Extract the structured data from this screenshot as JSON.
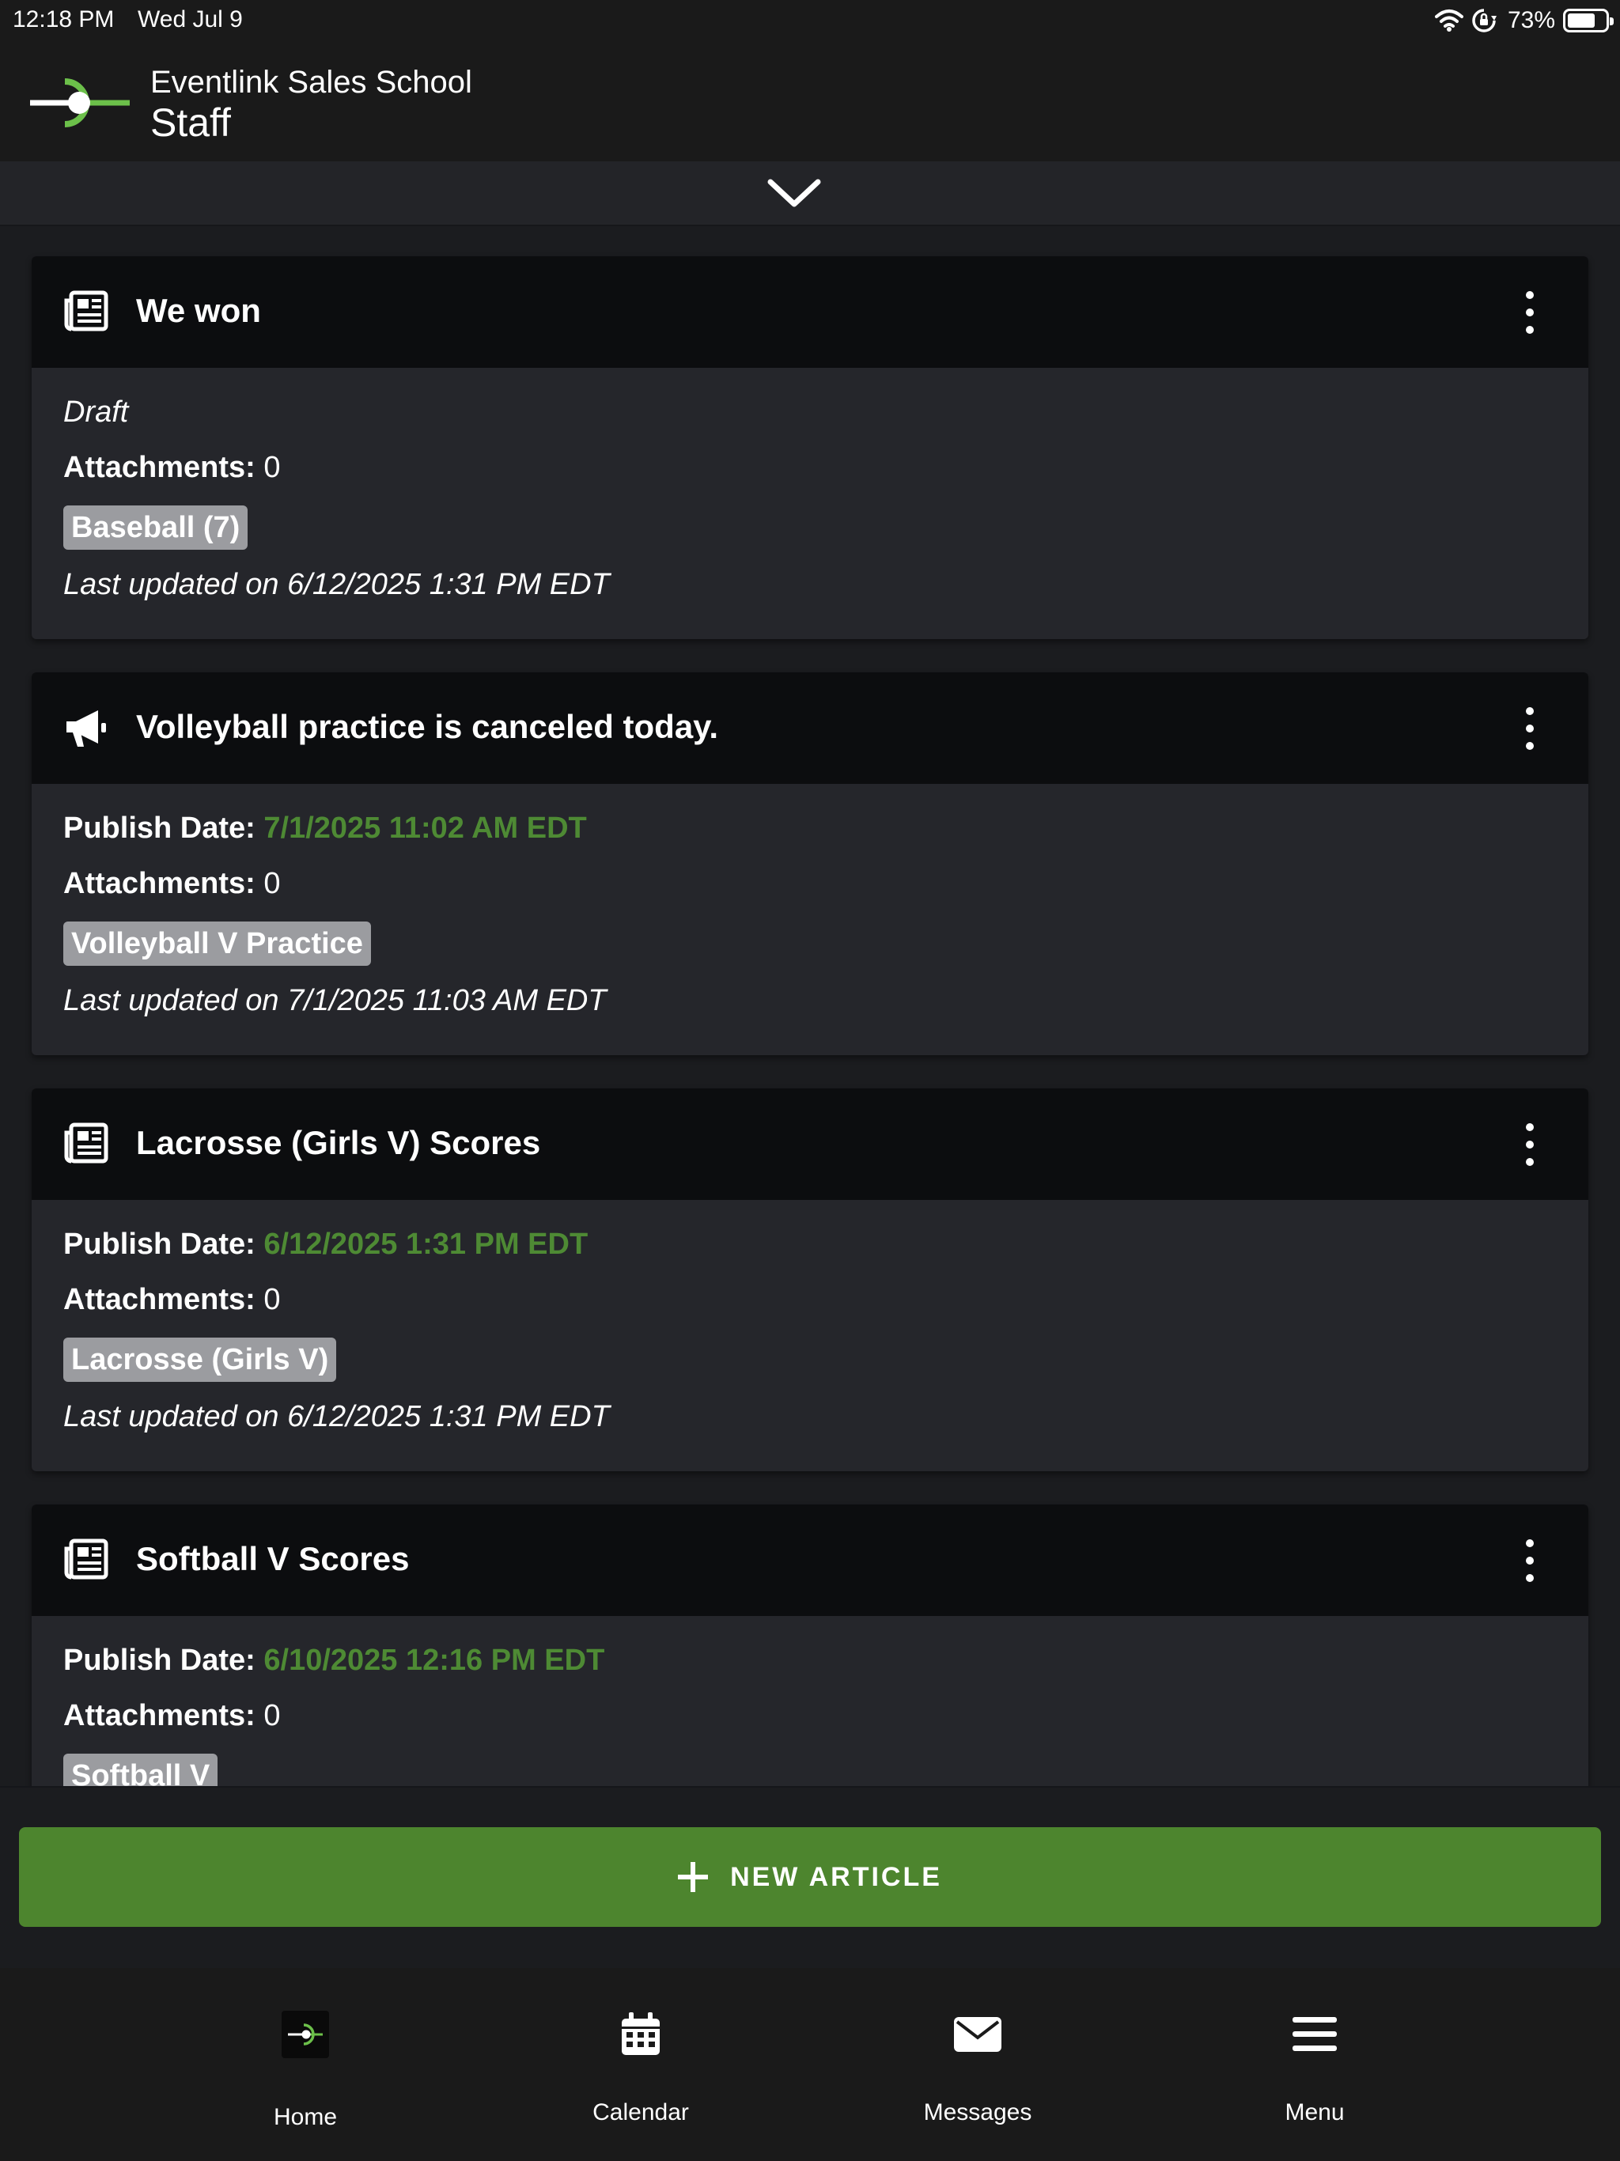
{
  "status_bar": {
    "time": "12:18 PM",
    "date": "Wed Jul 9",
    "battery_percent": "73%",
    "battery_level": 0.73
  },
  "header": {
    "school": "Eventlink Sales School",
    "role": "Staff"
  },
  "articles": [
    {
      "title": "We won",
      "icon": "newspaper-icon",
      "status": "Draft",
      "attachments_label": "Attachments:",
      "attachments_value": "0",
      "tag": "Baseball (7)",
      "updated": "Last updated on 6/12/2025 1:31 PM EDT"
    },
    {
      "title": "Volleyball practice is canceled today.",
      "icon": "megaphone-icon",
      "publish_label": "Publish Date:",
      "publish_value": "7/1/2025 11:02 AM EDT",
      "attachments_label": "Attachments:",
      "attachments_value": "0",
      "tag": "Volleyball V Practice",
      "updated": "Last updated on 7/1/2025 11:03 AM EDT"
    },
    {
      "title": "Lacrosse (Girls V) Scores",
      "icon": "newspaper-icon",
      "publish_label": "Publish Date:",
      "publish_value": "6/12/2025 1:31 PM EDT",
      "attachments_label": "Attachments:",
      "attachments_value": "0",
      "tag": "Lacrosse (Girls V)",
      "updated": "Last updated on 6/12/2025 1:31 PM EDT"
    },
    {
      "title": "Softball V Scores",
      "icon": "newspaper-icon",
      "publish_label": "Publish Date:",
      "publish_value": "6/10/2025 12:16 PM EDT",
      "attachments_label": "Attachments:",
      "attachments_value": "0",
      "tag": "Softball V"
    }
  ],
  "new_article_button": {
    "label": "NEW ARTICLE"
  },
  "tabs": [
    {
      "label": "Home",
      "icon": "home-logo-icon"
    },
    {
      "label": "Calendar",
      "icon": "calendar-icon"
    },
    {
      "label": "Messages",
      "icon": "envelope-icon"
    },
    {
      "label": "Menu",
      "icon": "hamburger-menu-icon"
    }
  ],
  "colors": {
    "accent_green": "#4d852e",
    "publish_green": "#4e8a34",
    "logo_green": "#6cc04a",
    "tag_gray": "#9b9ca0",
    "card_bg": "#25262b",
    "card_head_bg": "#0c0d0f"
  }
}
